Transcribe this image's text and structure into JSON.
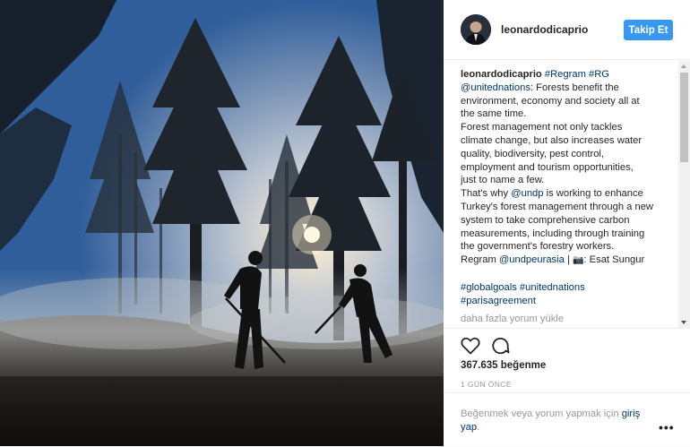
{
  "post": {
    "username": "leonardodicaprio",
    "follow_label": "Takip Et",
    "caption": {
      "l1_user": "leonardodicaprio",
      "l1_tags": " #Regram #RG",
      "l2_mention": "@unitednations",
      "l2_text": ": Forests benefit the",
      "l3": "environment, economy and society all at",
      "l4": "the same time.",
      "l5": "Forest management not only tackles",
      "l6": "climate change, but also increases water",
      "l7": "quality, biodiversity, pest control,",
      "l8": "employment and tourism opportunities,",
      "l9": "just to name a few.",
      "l10_pre": "That's why ",
      "l10_mention": "@undp",
      "l10_post": " is working to enhance",
      "l11": "Turkey's forest management through a new",
      "l12": "system to take comprehensive carbon",
      "l13": "measurements, including through training",
      "l14": "the government's forestry workers.",
      "l15_pre": "Regram ",
      "l15_mention": "@undpeurasia",
      "l15_sep": " | ",
      "l15_camera": "📷",
      "l15_credit": ": Esat Sungur",
      "tags_line1": "#globalgoals #unitednations",
      "tags_line2": "#parisagreement"
    },
    "load_more_comments": "daha fazla yorum yükle",
    "likes": "367.635 beğenme",
    "time_ago": "1 GÜN ÖNCE",
    "login_prompt_text": "Beğenmek veya yorum yapmak için ",
    "login_link": "giriş yap",
    "login_suffix": ".",
    "more_options": "•••"
  },
  "icons": {
    "like": "heart-icon",
    "comment": "comment-icon",
    "more": "more-options-icon"
  },
  "colors": {
    "follow_button": "#3897f0",
    "link": "#003569",
    "muted": "#999999"
  }
}
